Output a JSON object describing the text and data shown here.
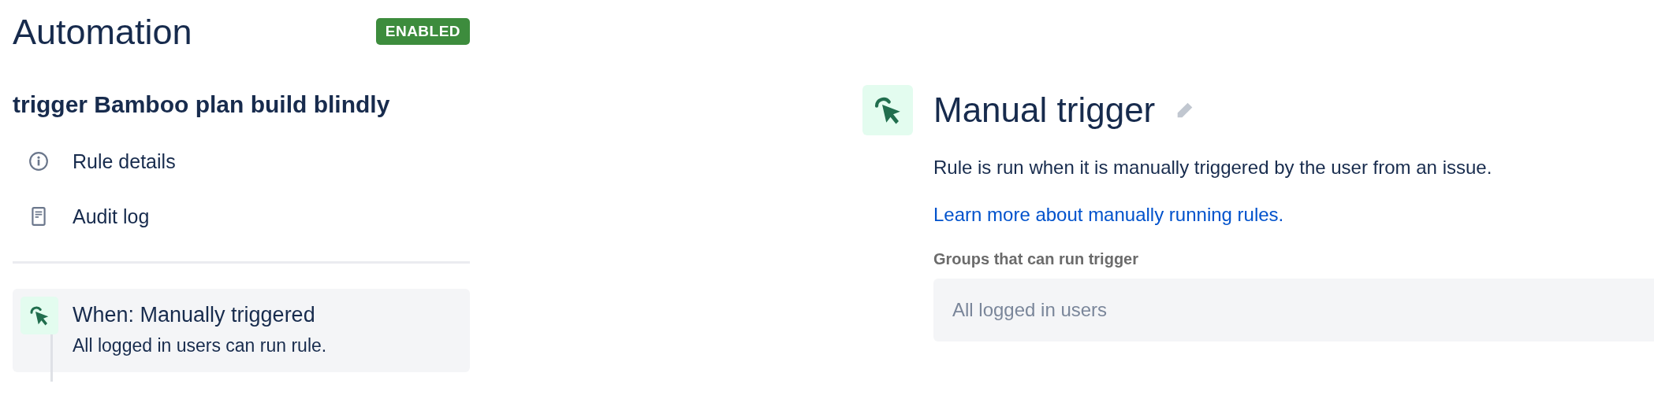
{
  "header": {
    "title": "Automation",
    "status_badge": "ENABLED"
  },
  "rule": {
    "name": "trigger Bamboo plan build blindly"
  },
  "sidebar": {
    "items": [
      {
        "kind": "info",
        "label": "Rule details"
      },
      {
        "kind": "log",
        "label": "Audit log"
      }
    ]
  },
  "steps": [
    {
      "title": "When: Manually triggered",
      "subtitle": "All logged in users can run rule."
    }
  ],
  "detail": {
    "title": "Manual trigger",
    "description": "Rule is run when it is manually triggered by the user from an issue.",
    "link": "Learn more about manually running rules.",
    "groups_field": {
      "label": "Groups that can run trigger",
      "placeholder": "All logged in users"
    }
  }
}
